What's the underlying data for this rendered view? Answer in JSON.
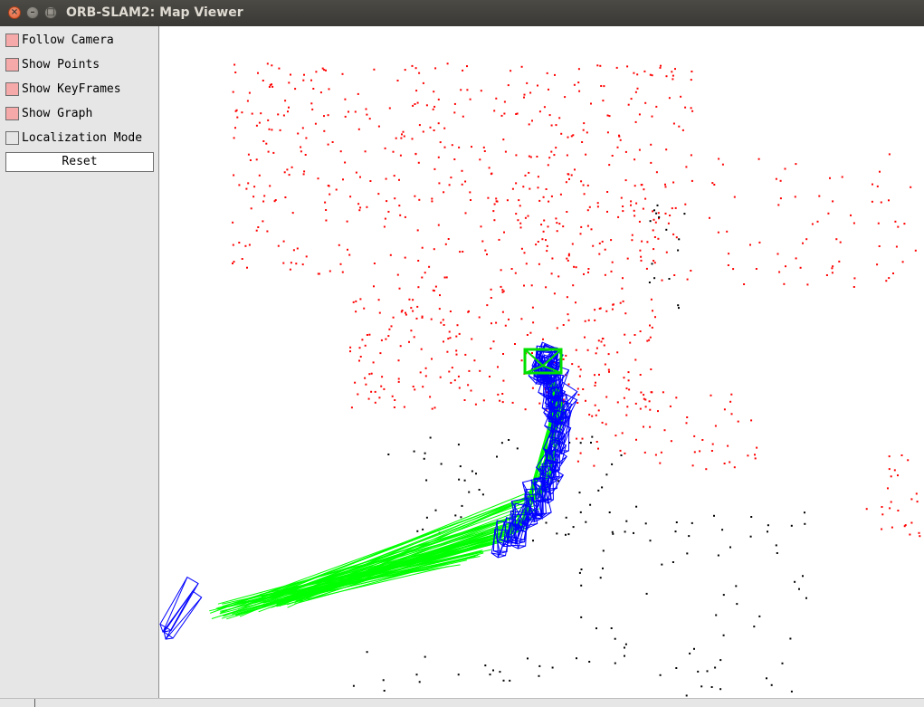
{
  "window": {
    "title": "ORB-SLAM2: Map Viewer",
    "close_glyph": "×",
    "minimize_glyph": "–",
    "maximize_glyph": "□"
  },
  "panel": {
    "options": [
      {
        "name": "follow-camera",
        "label": "Follow Camera",
        "checked": true
      },
      {
        "name": "show-points",
        "label": "Show Points",
        "checked": true
      },
      {
        "name": "show-keyframes",
        "label": "Show KeyFrames",
        "checked": true
      },
      {
        "name": "show-graph",
        "label": "Show Graph",
        "checked": true
      },
      {
        "name": "localization-mode",
        "label": "Localization Mode",
        "checked": false
      }
    ],
    "reset_label": "Reset"
  },
  "colors": {
    "map_point": "#ff0000",
    "reference_point": "#000000",
    "keyframe": "#0000ff",
    "graph_edge": "#00ff00",
    "current_camera": "#00e000",
    "checkbox_on": "#f6a9a9",
    "panel_background": "#e6e6e6"
  },
  "icons": {
    "close": "close-icon",
    "minimize": "minimize-icon",
    "maximize": "maximize-icon"
  }
}
